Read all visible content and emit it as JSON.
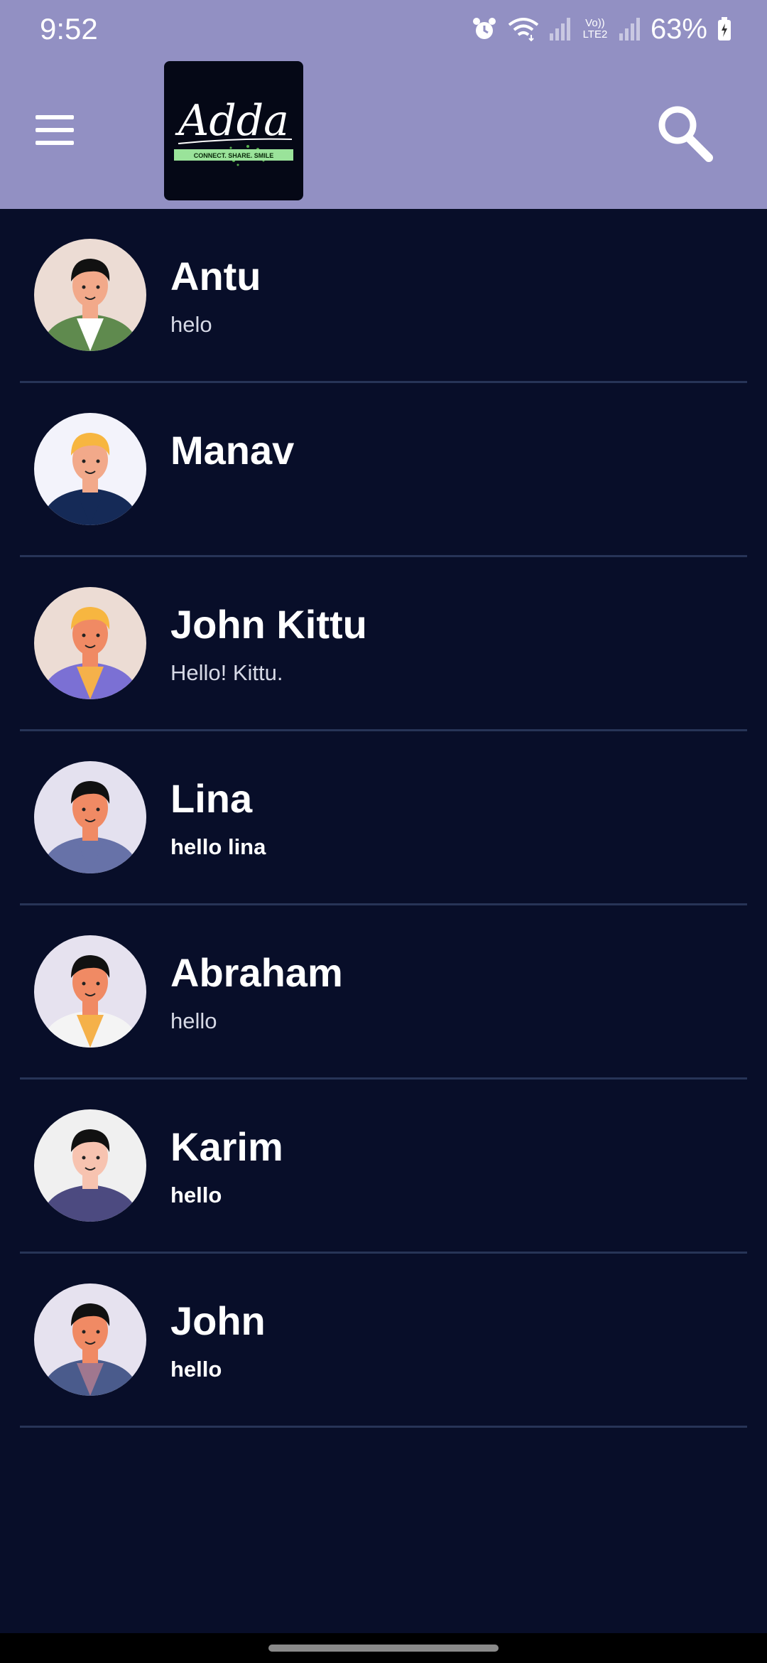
{
  "status_bar": {
    "time": "9:52",
    "network_label": "Vo)) LTE2",
    "battery": "63%"
  },
  "app_bar": {
    "logo_text": "Adda",
    "logo_tagline": "CONNECT. SHARE. SMILE",
    "menu_icon": "hamburger-menu-icon",
    "search_icon": "search-icon",
    "background_color": "#9290c3"
  },
  "chats": [
    {
      "name": "Antu",
      "message": "helo",
      "unread": false,
      "avatar": {
        "bg": "#ecdcd4",
        "skin": "#f2a98a",
        "hair": "#111111",
        "shirt": "#5f8a4e",
        "inner": "#ffffff"
      }
    },
    {
      "name": "Manav",
      "message": "",
      "unread": false,
      "avatar": {
        "bg": "#f3f3fb",
        "skin": "#f2a98a",
        "hair": "#f7b640",
        "shirt": "#152a57",
        "inner": "#152a57"
      }
    },
    {
      "name": "John Kittu",
      "message": "Hello! Kittu.",
      "unread": false,
      "avatar": {
        "bg": "#ecdcd4",
        "skin": "#f08a64",
        "hair": "#f7b640",
        "shirt": "#7b70d4",
        "inner": "#f5b14a"
      }
    },
    {
      "name": "Lina",
      "message": "hello lina",
      "unread": true,
      "avatar": {
        "bg": "#e4e1ef",
        "skin": "#f08a64",
        "hair": "#111111",
        "shirt": "#6772a8",
        "inner": "#6772a8"
      }
    },
    {
      "name": "Abraham",
      "message": "hello",
      "unread": false,
      "avatar": {
        "bg": "#e6e2ef",
        "skin": "#f08a64",
        "hair": "#111111",
        "shirt": "#f4f4f4",
        "inner": "#f5b14a"
      }
    },
    {
      "name": "Karim",
      "message": "hello",
      "unread": true,
      "avatar": {
        "bg": "#f0f0f0",
        "skin": "#f7c3b0",
        "hair": "#111111",
        "shirt": "#4c4a80",
        "inner": "#4c4a80"
      }
    },
    {
      "name": "John",
      "message": "hello",
      "unread": true,
      "avatar": {
        "bg": "#e6e2ef",
        "skin": "#f08a64",
        "hair": "#111111",
        "shirt": "#4a5b8c",
        "inner": "#a0778f"
      }
    }
  ]
}
